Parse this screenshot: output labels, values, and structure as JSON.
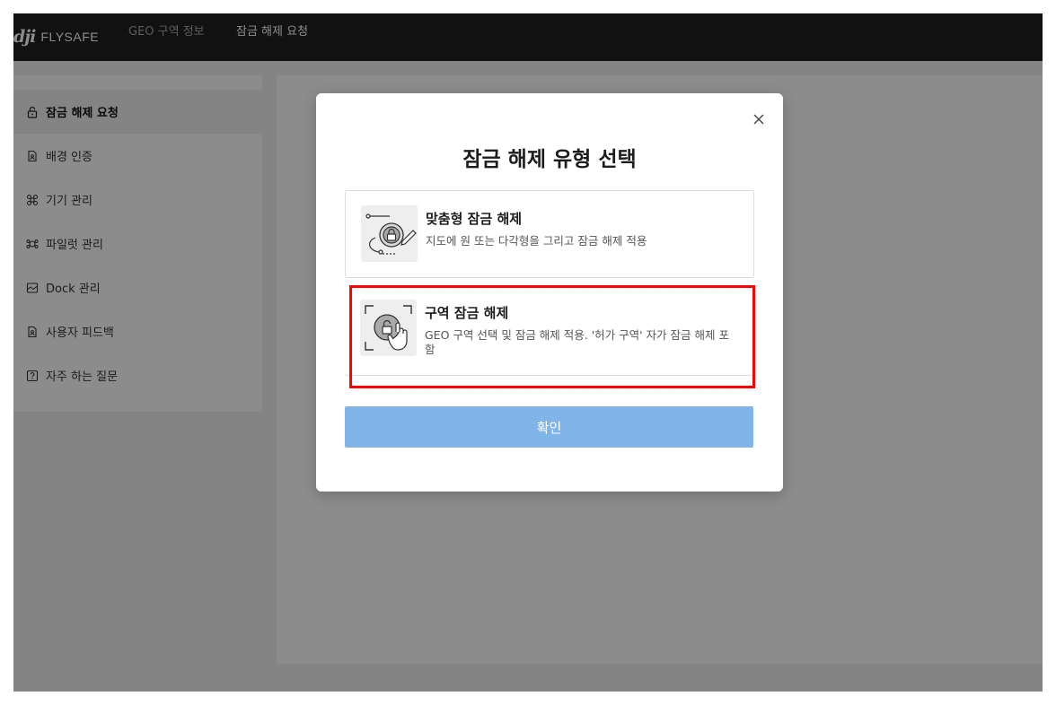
{
  "header": {
    "logo_mark": "dji",
    "logo_text": "FLYSAFE",
    "nav": [
      {
        "label": "GEO 구역 정보"
      },
      {
        "label": "잠금 해제 요청"
      }
    ]
  },
  "sidebar": {
    "items": [
      {
        "label": "잠금 해제 요청",
        "icon": "lock-icon",
        "active": true
      },
      {
        "label": "배경 인증",
        "icon": "document-icon"
      },
      {
        "label": "기기 관리",
        "icon": "drone-icon"
      },
      {
        "label": "파일럿 관리",
        "icon": "pilot-icon"
      },
      {
        "label": "Dock 관리",
        "icon": "dock-icon"
      },
      {
        "label": "사용자 피드백",
        "icon": "feedback-icon"
      },
      {
        "label": "자주 하는 질문",
        "icon": "faq-icon"
      }
    ]
  },
  "modal": {
    "title": "잠금 해제 유형 선택",
    "close_icon": "close-icon",
    "options": [
      {
        "title": "맞춤형 잠금 해제",
        "description": "지도에 원 또는 다각형을 그리고 잠금 해제 적용",
        "icon": "custom-unlock-icon"
      },
      {
        "title": "구역 잠금 해제",
        "description": "GEO 구역 선택 및 잠금 해제 적용. '허가 구역' 자가 잠금 해제 포함",
        "icon": "zone-unlock-icon"
      }
    ],
    "confirm_label": "확인"
  },
  "colors": {
    "topbar": "#1f1f1f",
    "confirm_button": "#81b4e9",
    "highlight": "#ff0000"
  }
}
